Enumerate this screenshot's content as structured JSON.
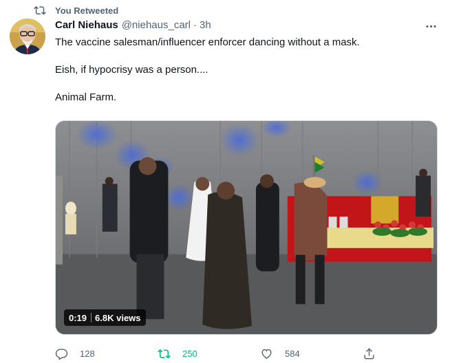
{
  "retweet_context": {
    "text": "You Retweeted",
    "icon": "retweet-icon"
  },
  "tweet": {
    "author_name": "Carl Niehaus",
    "handle": "@niehaus_carl",
    "separator": "·",
    "time": "3h",
    "paragraphs": [
      "The vaccine salesman/influencer enforcer dancing without a mask.",
      "Eish, if hypocrisy was a person....",
      "Animal Farm."
    ]
  },
  "video": {
    "duration": "0:19",
    "views": "6.8K views"
  },
  "actions": {
    "reply": {
      "icon": "reply-icon",
      "count": "128"
    },
    "retweet": {
      "icon": "retweet-icon",
      "count": "250",
      "active_color": "#00ba7c"
    },
    "like": {
      "icon": "heart-icon",
      "count": "584"
    },
    "share": {
      "icon": "share-icon"
    }
  },
  "colors": {
    "muted": "#536471",
    "text": "#0f1419",
    "retweet_active": "#00ba7c"
  }
}
